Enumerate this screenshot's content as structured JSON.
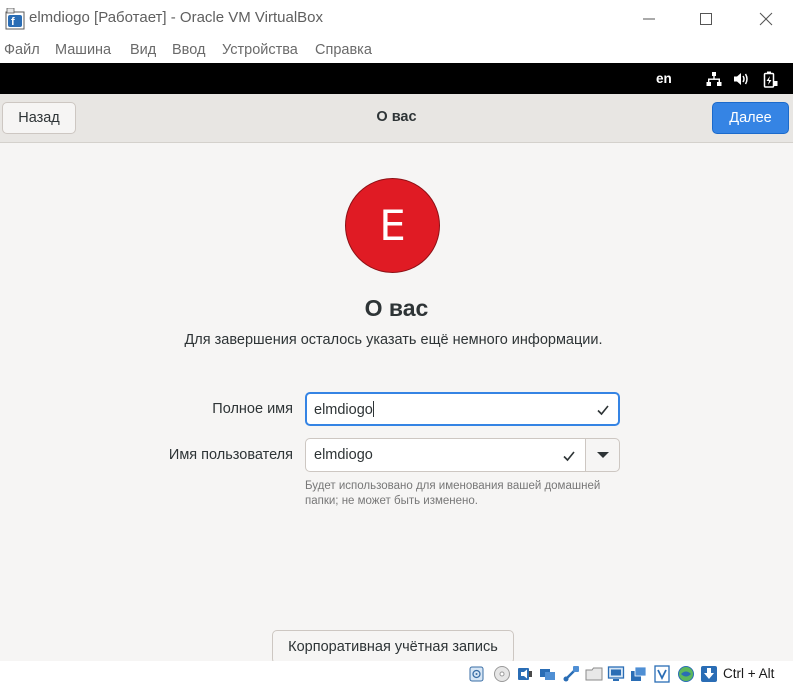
{
  "window": {
    "title": "elmdiogo [Работает] - Oracle VM VirtualBox"
  },
  "menu": [
    "Файл",
    "Машина",
    "Вид",
    "Ввод",
    "Устройства",
    "Справка"
  ],
  "topbar": {
    "language": "en"
  },
  "header": {
    "back_label": "Назад",
    "title": "О вас",
    "next_label": "Далее"
  },
  "avatar": {
    "initial": "E",
    "color": "#e01b24"
  },
  "main": {
    "heading": "О вас",
    "subtitle": "Для завершения осталось указать ещё немного информации."
  },
  "form": {
    "fullname_label": "Полное имя",
    "fullname_value": "elmdiogo",
    "username_label": "Имя пользователя",
    "username_value": "elmdiogo",
    "hint_line1": "Будет использовано для именования вашей домашней",
    "hint_line2": "папки; не может быть изменено."
  },
  "enterprise_button": "Корпоративная учётная запись",
  "statusbar": {
    "host_key": "Ctrl + Alt"
  },
  "colors": {
    "accent": "#3584e4",
    "topbar": "#000000",
    "background": "#f6f5f4"
  }
}
